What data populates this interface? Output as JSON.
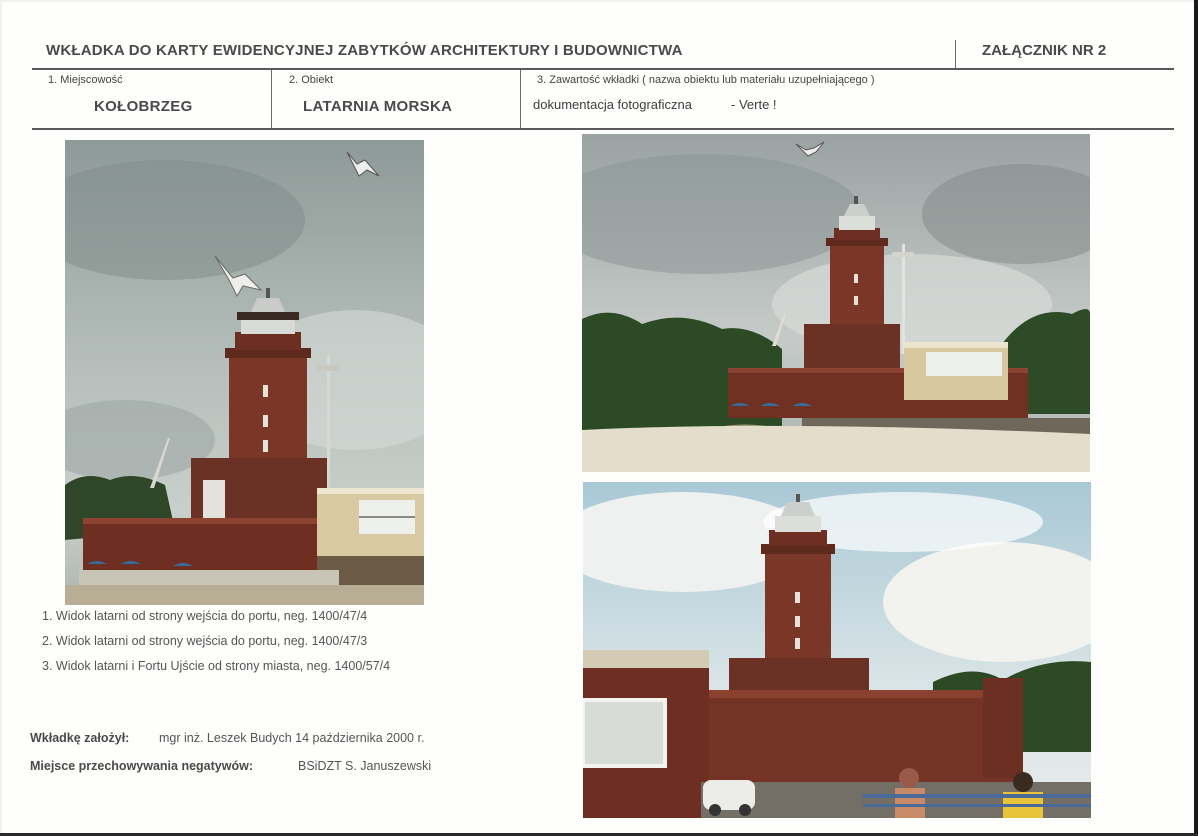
{
  "header": {
    "title": "WKŁADKA DO KARTY EWIDENCYJNEJ ZABYTKÓW ARCHITEKTURY I BUDOWNICTWA",
    "annex": "ZAŁĄCZNIK NR 2"
  },
  "fields": {
    "place_label": "1. Miejscowość",
    "place_value": "KOŁOBRZEG",
    "object_label": "2. Obiekt",
    "object_value": "LATARNIA MORSKA",
    "content_label": "3. Zawartość wkładki ( nazwa obiektu lub materiału uzupełniającego )",
    "content_value": "dokumentacja fotograficzna",
    "content_note": "- Verte !"
  },
  "captions": [
    "1. Widok latarni od strony wejścia do portu, neg. 1400/47/4",
    "2. Widok latarni od strony wejścia do portu, neg. 1400/47/3",
    "3. Widok latarni i Fortu Ujście od strony miasta, neg. 1400/57/4"
  ],
  "footer": {
    "created_label": "Wkładkę założył:",
    "created_value": "mgr inż. Leszek Budych  14 października 2000 r.",
    "storage_label": "Miejsce przechowywania negatywów:",
    "storage_value": "BSiDZT S. Januszewski"
  },
  "colors": {
    "text": "#4a4a4a",
    "brick": "#7a3626",
    "sky": "#9aa6a6",
    "foliage": "#2e4a26"
  }
}
